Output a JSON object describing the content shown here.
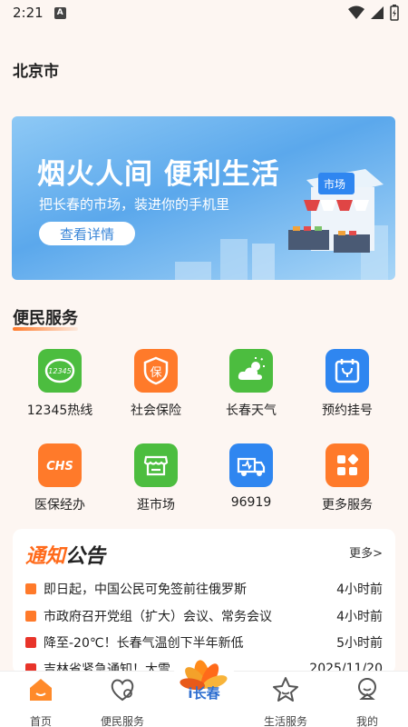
{
  "status": {
    "time": "2:21",
    "notif": "A"
  },
  "header": {
    "city": "北京市"
  },
  "banner": {
    "title": "烟火人间 便利生活",
    "subtitle": "把长春的市场，装进你的手机里",
    "button": "查看详情",
    "shop_sign": "市场"
  },
  "services": {
    "title": "便民服务",
    "items": [
      {
        "label": "12345热线",
        "icon": "hotline-icon",
        "color": "#4cbd3f",
        "glyph": "12345"
      },
      {
        "label": "社会保险",
        "icon": "insurance-icon",
        "color": "#ff7a2a",
        "glyph": "保"
      },
      {
        "label": "长春天气",
        "icon": "weather-icon",
        "color": "#4cbd3f",
        "glyph": ""
      },
      {
        "label": "预约挂号",
        "icon": "appointment-icon",
        "color": "#2f86f0",
        "glyph": ""
      },
      {
        "label": "医保经办",
        "icon": "medical-insurance-icon",
        "color": "#ff7a2a",
        "glyph": "CHS"
      },
      {
        "label": "逛市场",
        "icon": "market-icon",
        "color": "#4cbd3f",
        "glyph": ""
      },
      {
        "label": "96919",
        "icon": "truck-icon",
        "color": "#2f86f0",
        "glyph": ""
      },
      {
        "label": "更多服务",
        "icon": "more-services-icon",
        "color": "#ff7a2a",
        "glyph": ""
      }
    ]
  },
  "notice": {
    "title_accent": "通知",
    "title_rest": "公告",
    "more": "更多>",
    "items": [
      {
        "text": "即日起，中国公民可免签前往俄罗斯",
        "time": "4小时前",
        "color": "#ff7a2a"
      },
      {
        "text": "市政府召开党组（扩大）会议、常务会议",
        "time": "4小时前",
        "color": "#ff7a2a"
      },
      {
        "text": "降至-20℃！长春气温创下半年新低",
        "time": "5小时前",
        "color": "#e8342a"
      },
      {
        "text": "吉林省紧急通知！大雪……马上",
        "time": "2025/11/20",
        "color": "#e8342a"
      }
    ]
  },
  "tabbar": {
    "items": [
      {
        "label": "首页"
      },
      {
        "label": "便民服务"
      },
      {
        "label": "生活服务"
      },
      {
        "label": "我的"
      }
    ],
    "logo_text": "i长春"
  }
}
